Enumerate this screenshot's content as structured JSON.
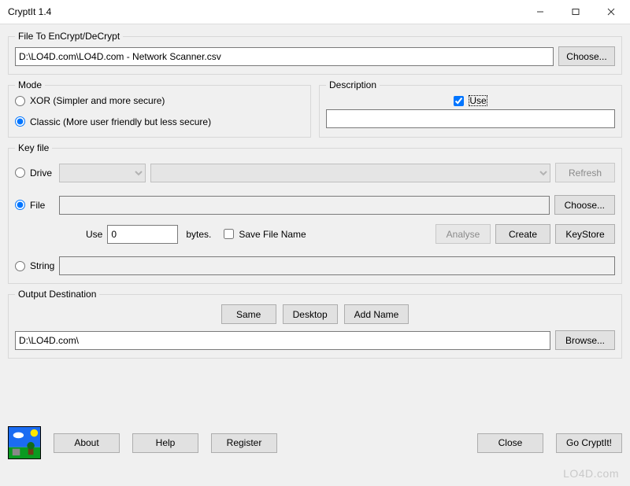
{
  "window": {
    "title": "CryptIt 1.4"
  },
  "file": {
    "legend": "File To EnCrypt/DeCrypt",
    "path": "D:\\LO4D.com\\LO4D.com - Network Scanner.csv",
    "choose": "Choose..."
  },
  "mode": {
    "legend": "Mode",
    "xor": "XOR (Simpler and more secure)",
    "classic": "Classic (More user friendly but less secure)"
  },
  "description": {
    "legend": "Description",
    "use": "Use"
  },
  "keyfile": {
    "legend": "Key file",
    "drive": "Drive",
    "file": "File",
    "string": "String",
    "refresh": "Refresh",
    "choose": "Choose...",
    "useLabel": "Use",
    "bytesValue": "0",
    "bytesLabel": "bytes.",
    "saveFileName": "Save File Name",
    "analyse": "Analyse",
    "create": "Create",
    "keystore": "KeyStore"
  },
  "output": {
    "legend": "Output Destination",
    "same": "Same",
    "desktop": "Desktop",
    "addName": "Add Name",
    "path": "D:\\LO4D.com\\",
    "browse": "Browse..."
  },
  "footer": {
    "about": "About",
    "help": "Help",
    "register": "Register",
    "close": "Close",
    "go": "Go CryptIt!"
  },
  "watermark": "LO4D.com"
}
